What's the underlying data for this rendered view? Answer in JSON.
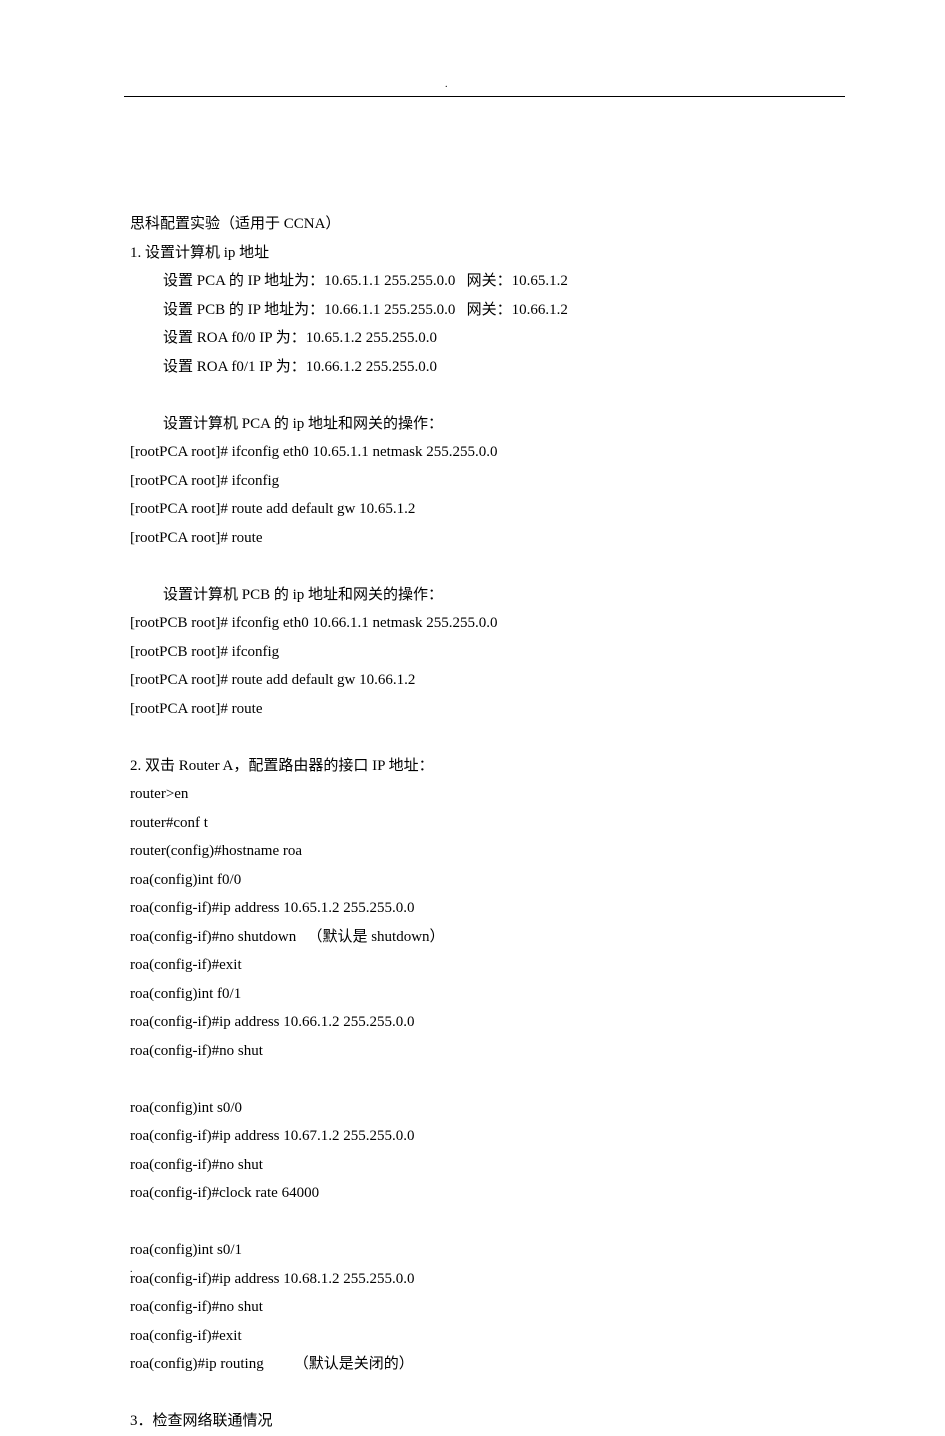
{
  "marks": {
    "dot": "."
  },
  "title": "思科配置实验（适用于 CCNA）",
  "s1": {
    "heading": "1. 设置计算机 ip 地址",
    "l1": "设置 PCA 的 IP 地址为：10.65.1.1 255.255.0.0   网关：10.65.1.2",
    "l2": "设置 PCB 的 IP 地址为：10.66.1.1 255.255.0.0   网关：10.66.1.2",
    "l3": "设置 ROA f0/0 IP 为：10.65.1.2 255.255.0.0",
    "l4": "设置 ROA f0/1 IP 为：10.66.1.2 255.255.0.0",
    "pcaHeading": "设置计算机 PCA 的 ip 地址和网关的操作：",
    "pca1": "[rootPCA root]# ifconfig eth0 10.65.1.1 netmask 255.255.0.0",
    "pca2": "[rootPCA root]# ifconfig",
    "pca3": "[rootPCA root]# route add default gw 10.65.1.2",
    "pca4": "[rootPCA root]# route",
    "pcbHeading": "设置计算机 PCB 的 ip 地址和网关的操作：",
    "pcb1": "[rootPCB root]# ifconfig eth0 10.66.1.1 netmask 255.255.0.0",
    "pcb2": "[rootPCB root]# ifconfig",
    "pcb3": "[rootPCA root]# route add default gw 10.66.1.2",
    "pcb4": "[rootPCA root]# route"
  },
  "s2": {
    "heading": "2. 双击 Router A，配置路由器的接口 IP 地址：",
    "l1": "router>en",
    "l2": "router#conf t",
    "l3": "router(config)#hostname roa",
    "l4": "roa(config)int f0/0",
    "l5": "roa(config-if)#ip address 10.65.1.2 255.255.0.0",
    "l6": "roa(config-if)#no shutdown   （默认是 shutdown）",
    "l7": "roa(config-if)#exit",
    "l8": "roa(config)int f0/1",
    "l9": "roa(config-if)#ip address 10.66.1.2 255.255.0.0",
    "l10": "roa(config-if)#no shut",
    "l11": "roa(config)int s0/0",
    "l12": "roa(config-if)#ip address 10.67.1.2 255.255.0.0",
    "l13": "roa(config-if)#no shut",
    "l14": "roa(config-if)#clock rate 64000",
    "l15": "roa(config)int s0/1",
    "l16": "roa(config-if)#ip address 10.68.1.2 255.255.0.0",
    "l17": "roa(config-if)#no shut",
    "l18": "roa(config-if)#exit",
    "l19": "roa(config)#ip routing        （默认是关闭的）"
  },
  "s3": {
    "heading": "3．检查网络联通情况"
  }
}
